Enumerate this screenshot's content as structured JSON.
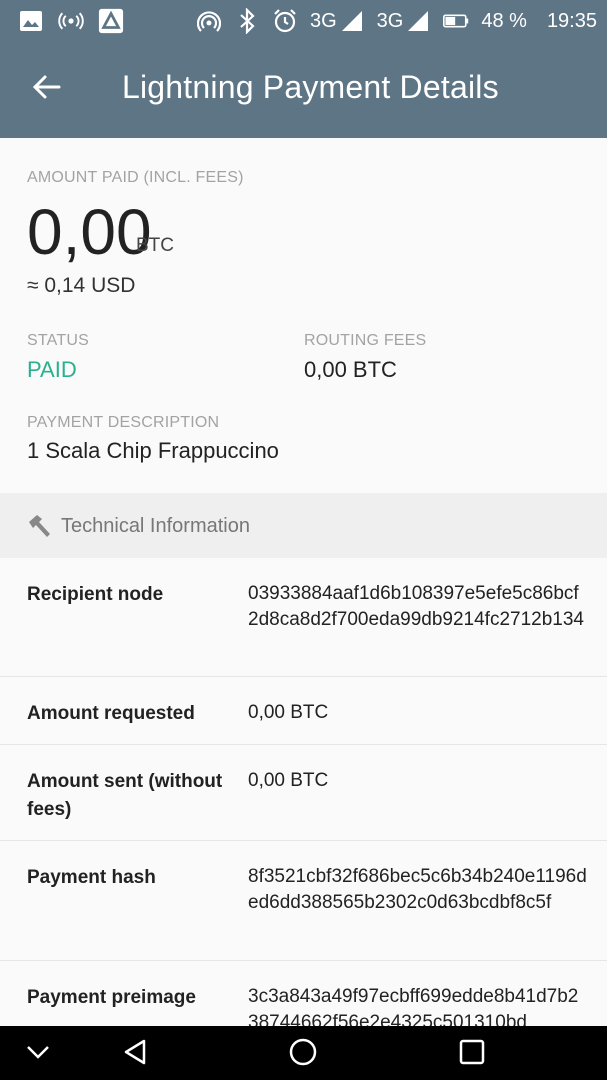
{
  "statusbar": {
    "network1": "3G",
    "network2": "3G",
    "battery": "48 %",
    "time": "19:35"
  },
  "appbar": {
    "title": "Lightning Payment Details"
  },
  "summary": {
    "amount_label": "AMOUNT PAID (INCL. FEES)",
    "amount_value": "0,00",
    "amount_unit": "BTC",
    "fiat_value": "≈ 0,14 USD",
    "status_label": "STATUS",
    "status_value": "PAID",
    "fees_label": "ROUTING FEES",
    "fees_value": "0,00 BTC",
    "desc_label": "PAYMENT DESCRIPTION",
    "desc_value": "1 Scala Chip Frappuccino"
  },
  "technical": {
    "title": "Technical Information",
    "rows": [
      {
        "key": "Recipient node",
        "value": "03933884aaf1d6b108397e5efe5c86bcf2d8ca8d2f700eda99db9214fc2712b134"
      },
      {
        "key": "Amount requested",
        "value": "0,00 BTC"
      },
      {
        "key": "Amount sent (without fees)",
        "value": "0,00 BTC"
      },
      {
        "key": "Payment hash",
        "value": "8f3521cbf32f686bec5c6b34b240e1196ded6dd388565b2302c0d63bcdbf8c5f"
      },
      {
        "key": "Payment preimage",
        "value": "3c3a843a49f97ecbff699edde8b41d7b238744662f56e2e4325c501310bd"
      }
    ]
  },
  "colors": {
    "appbar": "#5e7586",
    "status_paid": "#29b08e"
  },
  "icons": {
    "back": "arrow-left-icon",
    "technical": "hammer-icon",
    "nav_down": "chevron-down-icon",
    "nav_back": "triangle-back-icon",
    "nav_home": "circle-home-icon",
    "nav_recents": "square-recents-icon"
  }
}
